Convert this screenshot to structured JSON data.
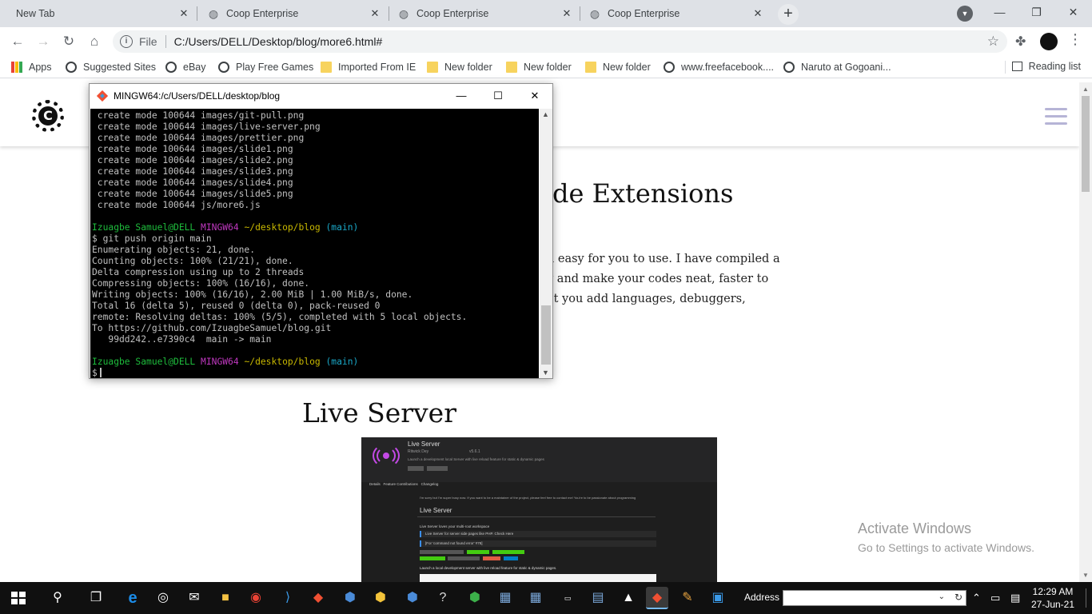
{
  "browser": {
    "tabs": [
      {
        "title": "New Tab",
        "active": false
      },
      {
        "title": "Coop Enterprise",
        "active": false
      },
      {
        "title": "Coop Enterprise",
        "active": false
      },
      {
        "title": "Coop Enterprise",
        "active": false
      }
    ],
    "address": {
      "scheme_label": "File",
      "url": "C:/Users/DELL/Desktop/blog/more6.html#"
    },
    "bookmarks": [
      {
        "label": "Apps",
        "icon": "apps-grid-icon"
      },
      {
        "label": "Suggested Sites",
        "icon": "globe-icon"
      },
      {
        "label": "eBay",
        "icon": "globe-icon"
      },
      {
        "label": "Play Free Games",
        "icon": "globe-icon"
      },
      {
        "label": "Imported From IE",
        "icon": "folder-icon"
      },
      {
        "label": "New folder",
        "icon": "folder-icon"
      },
      {
        "label": "New folder",
        "icon": "folder-icon"
      },
      {
        "label": "New folder",
        "icon": "folder-icon"
      },
      {
        "label": "www.freefacebook....",
        "icon": "globe-icon"
      },
      {
        "label": "Naruto at Gogoani...",
        "icon": "globe-icon"
      }
    ],
    "reading_list": "Reading list"
  },
  "page": {
    "logo_letter": "C",
    "article_heading": "de Extensions",
    "article_lines": [
      "d easy for you to use. I have compiled a",
      "y and make your codes neat, faster to",
      "et you add languages, debuggers,"
    ],
    "section_heading": "Live Server",
    "image": {
      "title": "Live Server",
      "author": "Ritwick Dey",
      "version": "v5.6.1",
      "description": "Launch a development local Server with live reload feature for static & dynamic pages",
      "tabs": [
        "Details",
        "Feature Contributions",
        "Changelog"
      ],
      "panel_heading": "Live Server",
      "panel_note": "I'm sorry but I'm super busy now. If you want to be a maintainer of the project, please feel free to contact me! You're to be passionate about programming",
      "loves_line": "Live Server loves your multi-root workspace",
      "php_line": "Live Server for server side pages like PHP. Check Here",
      "error_line": "[For 'command not found error' #78]",
      "launch_line": "Launch a local development server with live reload feature for static & dynamic pages."
    },
    "watermark": {
      "line1": "Activate Windows",
      "line2": "Go to Settings to activate Windows."
    }
  },
  "terminal": {
    "title": "MINGW64:/c/Users/DELL/desktop/blog",
    "lines": [
      {
        "t": "plain",
        "text": " create mode 100644 images/git-pull.png"
      },
      {
        "t": "plain",
        "text": " create mode 100644 images/live-server.png"
      },
      {
        "t": "plain",
        "text": " create mode 100644 images/prettier.png"
      },
      {
        "t": "plain",
        "text": " create mode 100644 images/slide1.png"
      },
      {
        "t": "plain",
        "text": " create mode 100644 images/slide2.png"
      },
      {
        "t": "plain",
        "text": " create mode 100644 images/slide3.png"
      },
      {
        "t": "plain",
        "text": " create mode 100644 images/slide4.png"
      },
      {
        "t": "plain",
        "text": " create mode 100644 images/slide5.png"
      },
      {
        "t": "plain",
        "text": " create mode 100644 js/more6.js"
      },
      {
        "t": "plain",
        "text": ""
      },
      {
        "t": "prompt",
        "user": "Izuagbe Samuel@DELL",
        "sys": "MINGW64",
        "path": "~/desktop/blog",
        "branch": "(main)"
      },
      {
        "t": "plain",
        "text": "$ git push origin main"
      },
      {
        "t": "plain",
        "text": "Enumerating objects: 21, done."
      },
      {
        "t": "plain",
        "text": "Counting objects: 100% (21/21), done."
      },
      {
        "t": "plain",
        "text": "Delta compression using up to 2 threads"
      },
      {
        "t": "plain",
        "text": "Compressing objects: 100% (16/16), done."
      },
      {
        "t": "plain",
        "text": "Writing objects: 100% (16/16), 2.00 MiB | 1.00 MiB/s, done."
      },
      {
        "t": "plain",
        "text": "Total 16 (delta 5), reused 0 (delta 0), pack-reused 0"
      },
      {
        "t": "plain",
        "text": "remote: Resolving deltas: 100% (5/5), completed with 5 local objects."
      },
      {
        "t": "plain",
        "text": "To https://github.com/IzuagbeSamuel/blog.git"
      },
      {
        "t": "plain",
        "text": "   99dd242..e7390c4  main -> main"
      },
      {
        "t": "plain",
        "text": ""
      },
      {
        "t": "prompt",
        "user": "Izuagbe Samuel@DELL",
        "sys": "MINGW64",
        "path": "~/desktop/blog",
        "branch": "(main)"
      },
      {
        "t": "input",
        "text": "$"
      }
    ]
  },
  "taskbar": {
    "address_label": "Address",
    "time": "12:29 AM",
    "date": "27-Jun-21"
  }
}
